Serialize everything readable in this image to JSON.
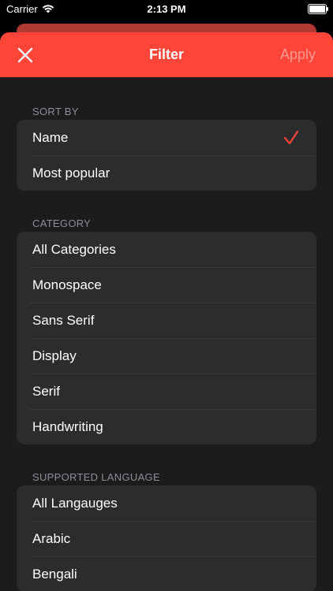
{
  "status": {
    "carrier": "Carrier",
    "time": "2:13 PM"
  },
  "nav": {
    "title": "Filter",
    "apply_label": "Apply",
    "accent": "#ff4438"
  },
  "sections": [
    {
      "header": "SORT BY",
      "items": [
        "Name",
        "Most popular"
      ],
      "selected": "Name"
    },
    {
      "header": "CATEGORY",
      "items": [
        "All Categories",
        "Monospace",
        "Sans Serif",
        "Display",
        "Serif",
        "Handwriting"
      ]
    },
    {
      "header": "SUPPORTED LANGUAGE",
      "items": [
        "All Langauges",
        "Arabic",
        "Bengali"
      ]
    }
  ]
}
